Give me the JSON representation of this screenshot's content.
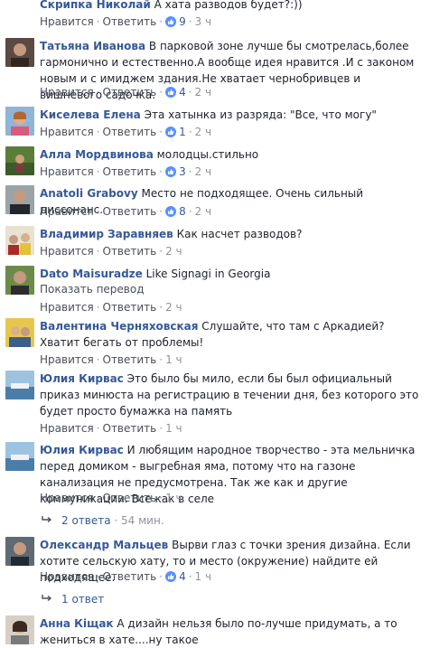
{
  "labels": {
    "like": "Нравится",
    "reply": "Ответить",
    "translate": "Показать перевод"
  },
  "colors": {
    "author": "#365899",
    "meta": "#90949c",
    "text": "#1d2129",
    "like_badge": "#5890ff"
  },
  "comments": [
    {
      "author": "Скрипка Николай",
      "text": "А хата разводов будет?:))",
      "likes": "9",
      "time": "3 ч"
    },
    {
      "author": "Татьяна Иванова",
      "text": "В парковой зоне лучше бы смотрелась,более гармонично и естественно.А вообще идея нравится .И с законом новым и с имиджем здания.Не хватает чернобривцев и вишневого садочка.",
      "likes": "4",
      "time": "2 ч"
    },
    {
      "author": "Киселева Елена",
      "text": "Эта хатынка из разряда: \"Все, что могу\"",
      "likes": "1",
      "time": "2 ч"
    },
    {
      "author": "Алла Мордвинова",
      "text": "молодцы.стильно",
      "likes": "3",
      "time": "2 ч"
    },
    {
      "author": "Anatoli Grabovy",
      "text": "Место не подходящее. Очень сильный диссонанс.",
      "likes": "8",
      "time": "2 ч"
    },
    {
      "author": "Владимир Заравняев",
      "text": "Как насчет разводов?",
      "likes": "",
      "time": "2 ч"
    },
    {
      "author": "Dato Maisuradze",
      "text": "Like Signagi in Georgia",
      "likes": "",
      "time": "2 ч"
    },
    {
      "author": "Валентина Черняховская",
      "text": "Слушайте, что там с Аркадией? Хватит бегать от проблемы!",
      "likes": "",
      "time": "1 ч"
    },
    {
      "author": "Юлия Кирвас",
      "text": "Это было бы мило, если бы был официальный приказ минюста на регистрацию в течении дня, без которого это будет просто бумажка на память",
      "likes": "",
      "time": "1 ч"
    },
    {
      "author": "Юлия Кирвас",
      "text": "И любящим народное творчество - эта мельничка перед домиком - выгребная яма, потому что на газоне канализация не предусмотрена. Так же как и другие коммуникации. Все как в селе",
      "likes": "",
      "time": "1 ч",
      "replies": "2 ответа",
      "replies_time": "54 мин."
    },
    {
      "author": "Олександр Мальцев",
      "text": "Вырви глаз с точки зрения дизайна. Если хотите сельскую хату, то и место (окружение) найдите ей подходящее.",
      "likes": "4",
      "time": "1 ч",
      "replies": "1 ответ"
    },
    {
      "author": "Анна Кіщак",
      "text": "А дизайн нельзя было по-лучше придумать, а то жениться в хате....ну такое",
      "likes": "",
      "time": ""
    }
  ]
}
